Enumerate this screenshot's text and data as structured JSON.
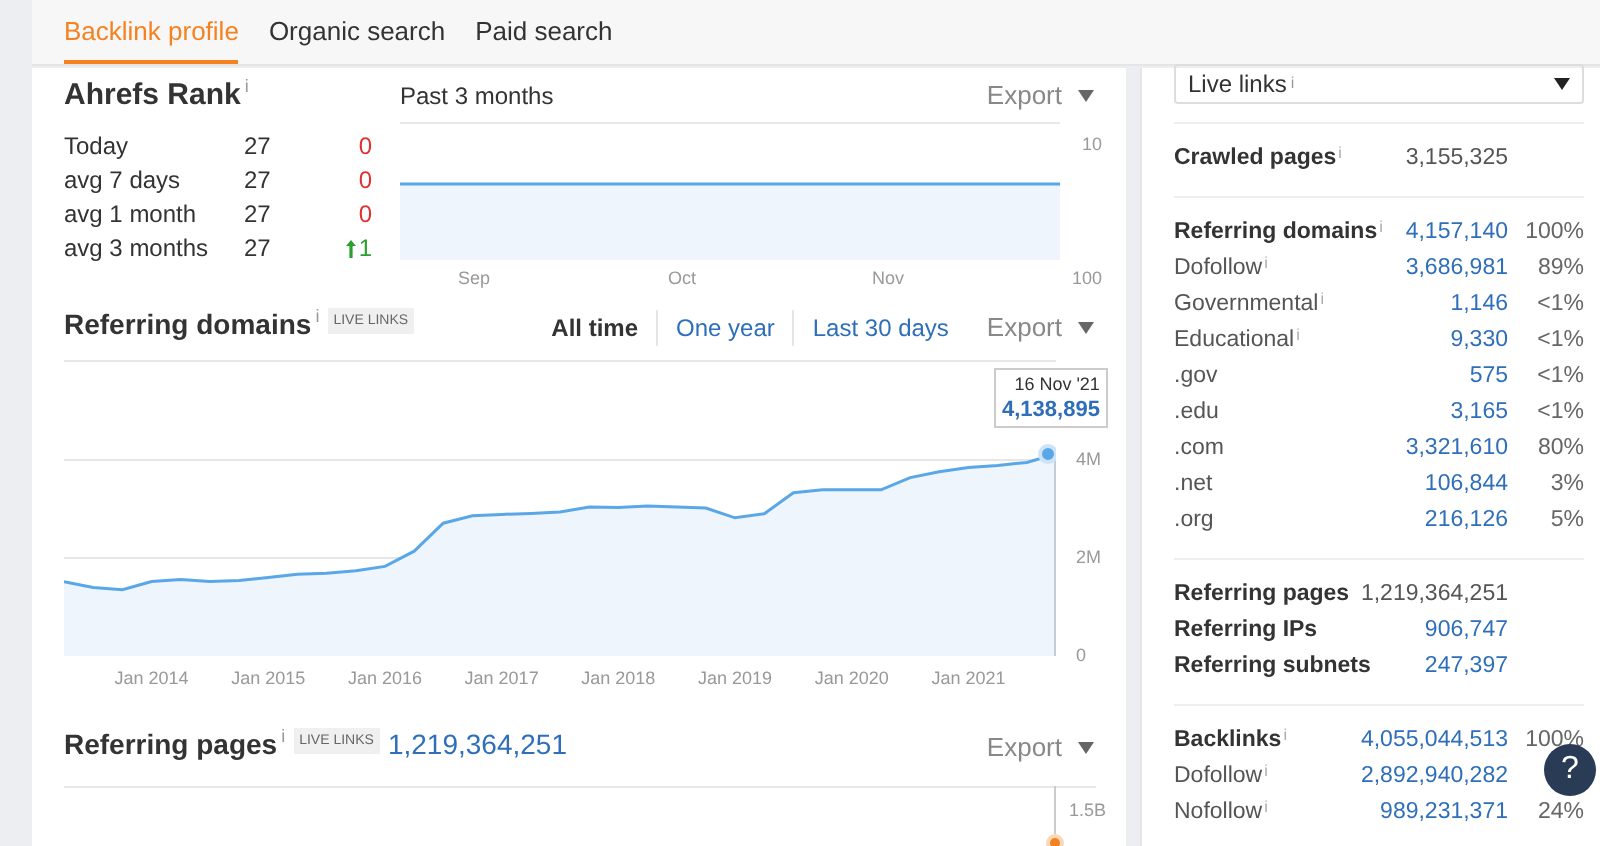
{
  "tabs": [
    {
      "label": "Backlink profile",
      "selected": true
    },
    {
      "label": "Organic search",
      "selected": false
    },
    {
      "label": "Paid search",
      "selected": false
    }
  ],
  "ahrefs_rank": {
    "title": "Ahrefs Rank",
    "info": "i",
    "rows": [
      {
        "label": "Today",
        "value": "27",
        "change": "0",
        "kind": "flat"
      },
      {
        "label": "avg 7 days",
        "value": "27",
        "change": "0",
        "kind": "flat"
      },
      {
        "label": "avg 1 month",
        "value": "27",
        "change": "0",
        "kind": "flat"
      },
      {
        "label": "avg 3 months",
        "value": "27",
        "change": "1",
        "kind": "up"
      }
    ],
    "chart": {
      "title": "Past 3 months",
      "export": "Export",
      "y_labels": [
        "10",
        "100"
      ],
      "x_labels": [
        "Sep",
        "Oct",
        "Nov"
      ]
    }
  },
  "referring_domains": {
    "title": "Referring domains",
    "info": "i",
    "badge": "LIVE LINKS",
    "ranges": [
      {
        "label": "All time",
        "selected": true
      },
      {
        "label": "One year",
        "selected": false
      },
      {
        "label": "Last 30 days",
        "selected": false
      }
    ],
    "export": "Export",
    "tooltip": {
      "date": "16 Nov '21",
      "value": "4,138,895"
    },
    "chart_data": {
      "type": "area",
      "categories": [
        null,
        null,
        null,
        "Jan 2014",
        null,
        null,
        null,
        "Jan 2015",
        null,
        null,
        null,
        "Jan 2016",
        null,
        null,
        null,
        "Jan 2017",
        null,
        null,
        null,
        "Jan 2018",
        null,
        null,
        null,
        "Jan 2019",
        null,
        null,
        null,
        "Jan 2020",
        null,
        null,
        null,
        "Jan 2021",
        null,
        null,
        null
      ],
      "series": [
        {
          "color": "#5aa7e8",
          "values": [
            1.52,
            1.4,
            1.35,
            1.52,
            1.56,
            1.52,
            1.54,
            1.6,
            1.67,
            1.69,
            1.74,
            1.83,
            2.14,
            2.71,
            2.86,
            2.89,
            2.91,
            2.94,
            3.04,
            3.03,
            3.06,
            3.04,
            3.02,
            2.82,
            2.9,
            3.33,
            3.39,
            3.39,
            3.39,
            3.64,
            3.76,
            3.85,
            3.89,
            3.95,
            4.12
          ]
        }
      ],
      "ylim": [
        0,
        6.04
      ],
      "yticks": [
        {
          "value": 0,
          "label": "0"
        },
        {
          "value": 2,
          "label": "2M"
        },
        {
          "value": 4,
          "label": "4M"
        }
      ]
    }
  },
  "referring_pages": {
    "title": "Referring pages",
    "info": "i",
    "badge": "LIVE LINKS",
    "value": "1,219,364,251",
    "export": "Export",
    "y_labels": [
      "1.5B"
    ]
  },
  "sidebar": {
    "dropdown": {
      "value": "Live links",
      "info": "i"
    },
    "groups": [
      {
        "rows": [
          {
            "label": "Crawled pages",
            "info": "i",
            "bold": true,
            "value": "3,155,325",
            "linked": false
          }
        ]
      },
      {
        "rows": [
          {
            "label": "Referring domains",
            "info": "i",
            "bold": true,
            "value": "4,157,140",
            "linked": true,
            "percent": "100%"
          },
          {
            "label": "Dofollow",
            "info": "i",
            "bold": false,
            "value": "3,686,981",
            "linked": true,
            "percent": "89%"
          },
          {
            "label": "Governmental",
            "info": "i",
            "bold": false,
            "value": "1,146",
            "linked": true,
            "percent": "<1%"
          },
          {
            "label": "Educational",
            "info": "i",
            "bold": false,
            "value": "9,330",
            "linked": true,
            "percent": "<1%"
          },
          {
            "label": ".gov",
            "bold": false,
            "value": "575",
            "linked": true,
            "percent": "<1%"
          },
          {
            "label": ".edu",
            "bold": false,
            "value": "3,165",
            "linked": true,
            "percent": "<1%"
          },
          {
            "label": ".com",
            "bold": false,
            "value": "3,321,610",
            "linked": true,
            "percent": "80%"
          },
          {
            "label": ".net",
            "bold": false,
            "value": "106,844",
            "linked": true,
            "percent": "3%"
          },
          {
            "label": ".org",
            "bold": false,
            "value": "216,126",
            "linked": true,
            "percent": "5%"
          }
        ]
      },
      {
        "rows": [
          {
            "label": "Referring pages",
            "bold": true,
            "value": "1,219,364,251",
            "linked": false
          },
          {
            "label": "Referring IPs",
            "bold": true,
            "value": "906,747",
            "linked": true
          },
          {
            "label": "Referring subnets",
            "bold": true,
            "value": "247,397",
            "linked": true
          }
        ]
      },
      {
        "rows": [
          {
            "label": "Backlinks",
            "info": "i",
            "bold": true,
            "value": "4,055,044,513",
            "linked": true,
            "percent": "100%"
          },
          {
            "label": "Dofollow",
            "info": "i",
            "bold": false,
            "value": "2,892,940,282",
            "linked": true
          },
          {
            "label": "Nofollow",
            "info": "i",
            "bold": false,
            "value": "989,231,371",
            "linked": true,
            "percent": "24%"
          }
        ]
      }
    ]
  },
  "help_button": "?"
}
